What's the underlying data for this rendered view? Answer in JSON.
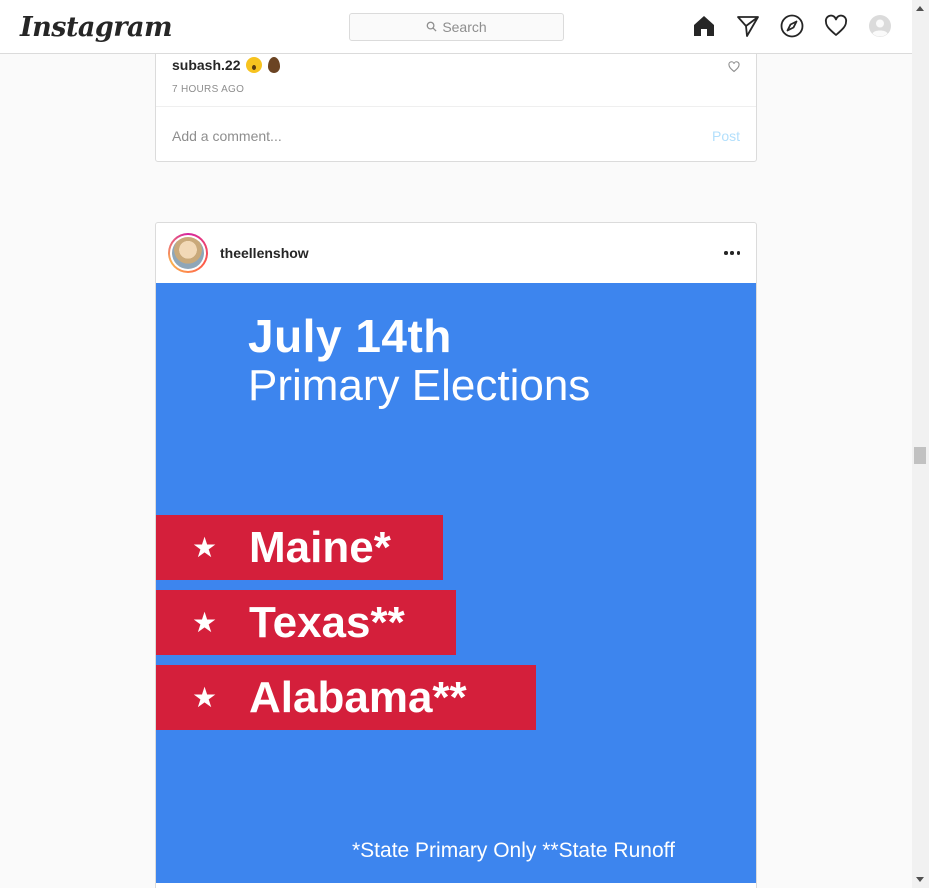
{
  "nav": {
    "logo": "Instagram",
    "search_placeholder": "Search",
    "icons": [
      "home-icon",
      "direct-icon",
      "explore-icon",
      "activity-heart-icon",
      "profile-avatar-icon"
    ]
  },
  "previous_post": {
    "comment": {
      "username": "subash.22",
      "emojis": [
        "astonished-face",
        "raised-fist-dark"
      ],
      "time": "7 HOURS AGO"
    },
    "add_comment_placeholder": "Add a comment...",
    "post_label": "Post"
  },
  "post": {
    "username": "theellenshow",
    "image": {
      "title": "July 14th",
      "subtitle": "Primary Elections",
      "states": [
        {
          "star": "★",
          "name": "Maine*"
        },
        {
          "star": "★",
          "name": "Texas**"
        },
        {
          "star": "★",
          "name": "Alabama**"
        }
      ],
      "footnote": "*State Primary Only  **State Runoff",
      "colors": {
        "background": "#3d85ee",
        "banner": "#d41f3b"
      }
    }
  }
}
